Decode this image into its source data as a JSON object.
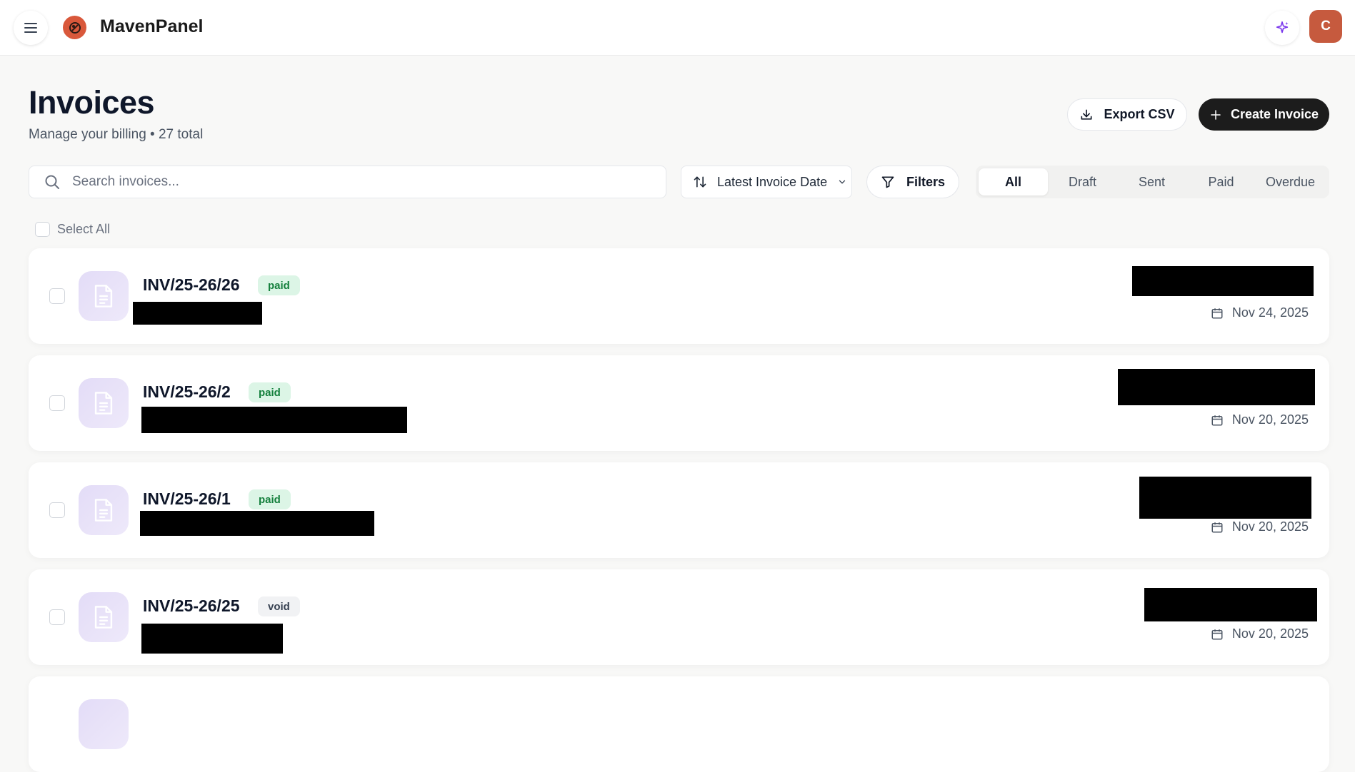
{
  "app": {
    "name": "MavenPanel",
    "avatar_initial": "C",
    "logo_color": "#d9583b",
    "avatar_color": "#c65a3e"
  },
  "icons": {
    "menu": "menu-icon",
    "ai": "sparkle-icon",
    "download": "download-icon",
    "plus": "plus-icon",
    "search": "search-icon",
    "sort": "sort-arrows-icon",
    "chevron": "chevron-down-icon",
    "filter": "filter-icon",
    "document": "document-icon",
    "calendar": "calendar-icon"
  },
  "header": {
    "title": "Invoices",
    "subtitle": "Manage your billing • 27 total",
    "export_label": "Export CSV",
    "create_label": "Create Invoice"
  },
  "toolbar": {
    "search_placeholder": "Search invoices...",
    "search_value": "",
    "sort_label": "Latest Invoice Date",
    "filters_label": "Filters",
    "tabs": [
      {
        "label": "All",
        "active": true
      },
      {
        "label": "Draft",
        "active": false
      },
      {
        "label": "Sent",
        "active": false
      },
      {
        "label": "Paid",
        "active": false
      },
      {
        "label": "Overdue",
        "active": false
      }
    ]
  },
  "list": {
    "select_all_label": "Select All",
    "invoices": [
      {
        "number": "INV/25-26/26",
        "status": "paid",
        "date": "Nov 24, 2025"
      },
      {
        "number": "INV/25-26/2",
        "status": "paid",
        "date": "Nov 20, 2025"
      },
      {
        "number": "INV/25-26/1",
        "status": "paid",
        "date": "Nov 20, 2025"
      },
      {
        "number": "INV/25-26/25",
        "status": "void",
        "date": "Nov 20, 2025"
      }
    ]
  }
}
